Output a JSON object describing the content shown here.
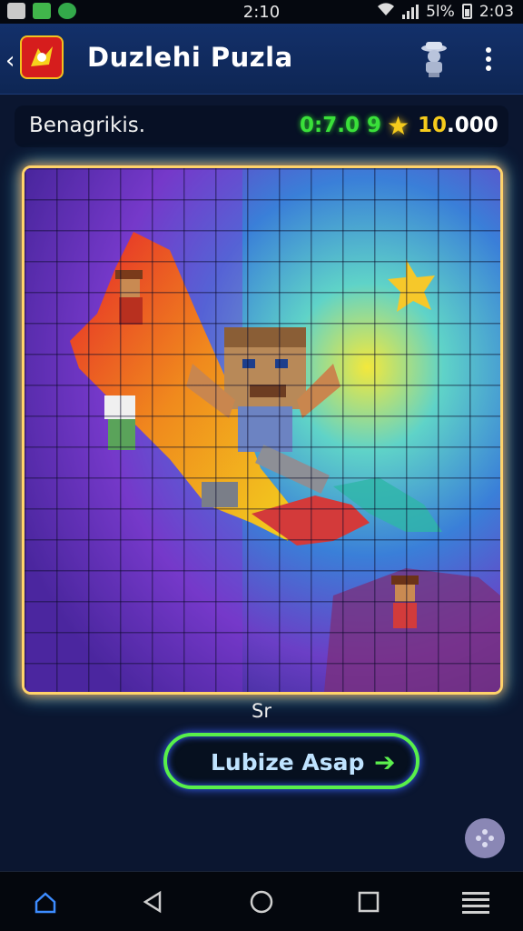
{
  "status_bar": {
    "time_center": "2:10",
    "battery_text": "5l%",
    "time_right": "2:03"
  },
  "app_bar": {
    "title": "Duzlehi Puzla"
  },
  "info_bar": {
    "player_name": "Benagrikis.",
    "timer": "0:7.0 9",
    "score_main": "10",
    "score_suffix": ".000"
  },
  "board": {
    "caption": "Sr"
  },
  "cta": {
    "label": "Lubize Asap",
    "arrow": "➔"
  },
  "colors": {
    "accent_green": "#58ef4a",
    "gold": "#f5cb1c",
    "appbar": "#13306a"
  },
  "icons": [
    "back-arrow-icon",
    "app-logo-icon",
    "guide-icon",
    "more-options-icon",
    "star-icon",
    "arrow-right-icon",
    "fab-menu-icon",
    "home-icon",
    "back-icon",
    "recents-icon",
    "menu-lines-icon"
  ]
}
